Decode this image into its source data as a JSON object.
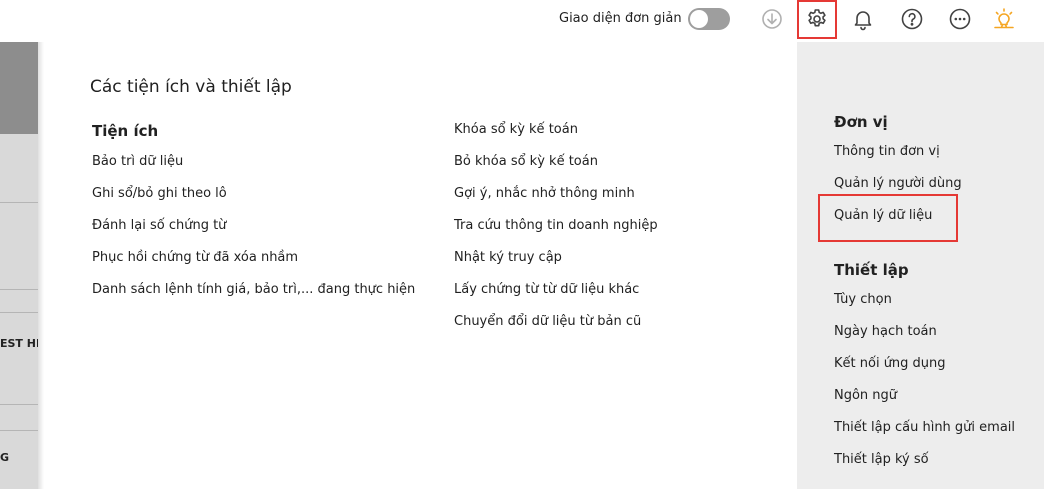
{
  "topbar": {
    "simple_mode_label": "Giao diện đơn giản",
    "simple_mode_on": false,
    "icons": [
      "download-icon",
      "gear-icon",
      "bell-icon",
      "help-icon",
      "more-icon",
      "lightbulb-icon"
    ],
    "highlight_color": "#e53935"
  },
  "left_strip": {
    "fragments": [
      "EST HE",
      "G"
    ]
  },
  "panel": {
    "title": "Các tiện ích và thiết lập",
    "utilities": {
      "heading": "Tiện ích",
      "col1": [
        "Bảo trì dữ liệu",
        "Ghi sổ/bỏ ghi theo lô",
        "Đánh lại số chứng từ",
        "Phục hồi chứng từ đã xóa nhầm",
        "Danh sách lệnh tính giá, bảo trì,... đang thực hiện"
      ],
      "col2": [
        "Khóa sổ kỳ kế toán",
        "Bỏ khóa sổ kỳ kế toán",
        "Gợi ý, nhắc nhở thông minh",
        "Tra cứu thông tin doanh nghiệp",
        "Nhật ký truy cập",
        "Lấy chứng từ từ dữ liệu khác",
        "Chuyển đổi dữ liệu từ bản cũ"
      ]
    }
  },
  "right_panel": {
    "unit": {
      "heading": "Đơn vị",
      "items": [
        "Thông tin đơn vị",
        "Quản lý người dùng",
        "Quản lý dữ liệu"
      ]
    },
    "settings": {
      "heading": "Thiết lập",
      "items": [
        "Tùy chọn",
        "Ngày hạch toán",
        "Kết nối ứng dụng",
        "Ngôn ngữ",
        "Thiết lập cấu hình gửi email",
        "Thiết lập ký số"
      ]
    }
  }
}
